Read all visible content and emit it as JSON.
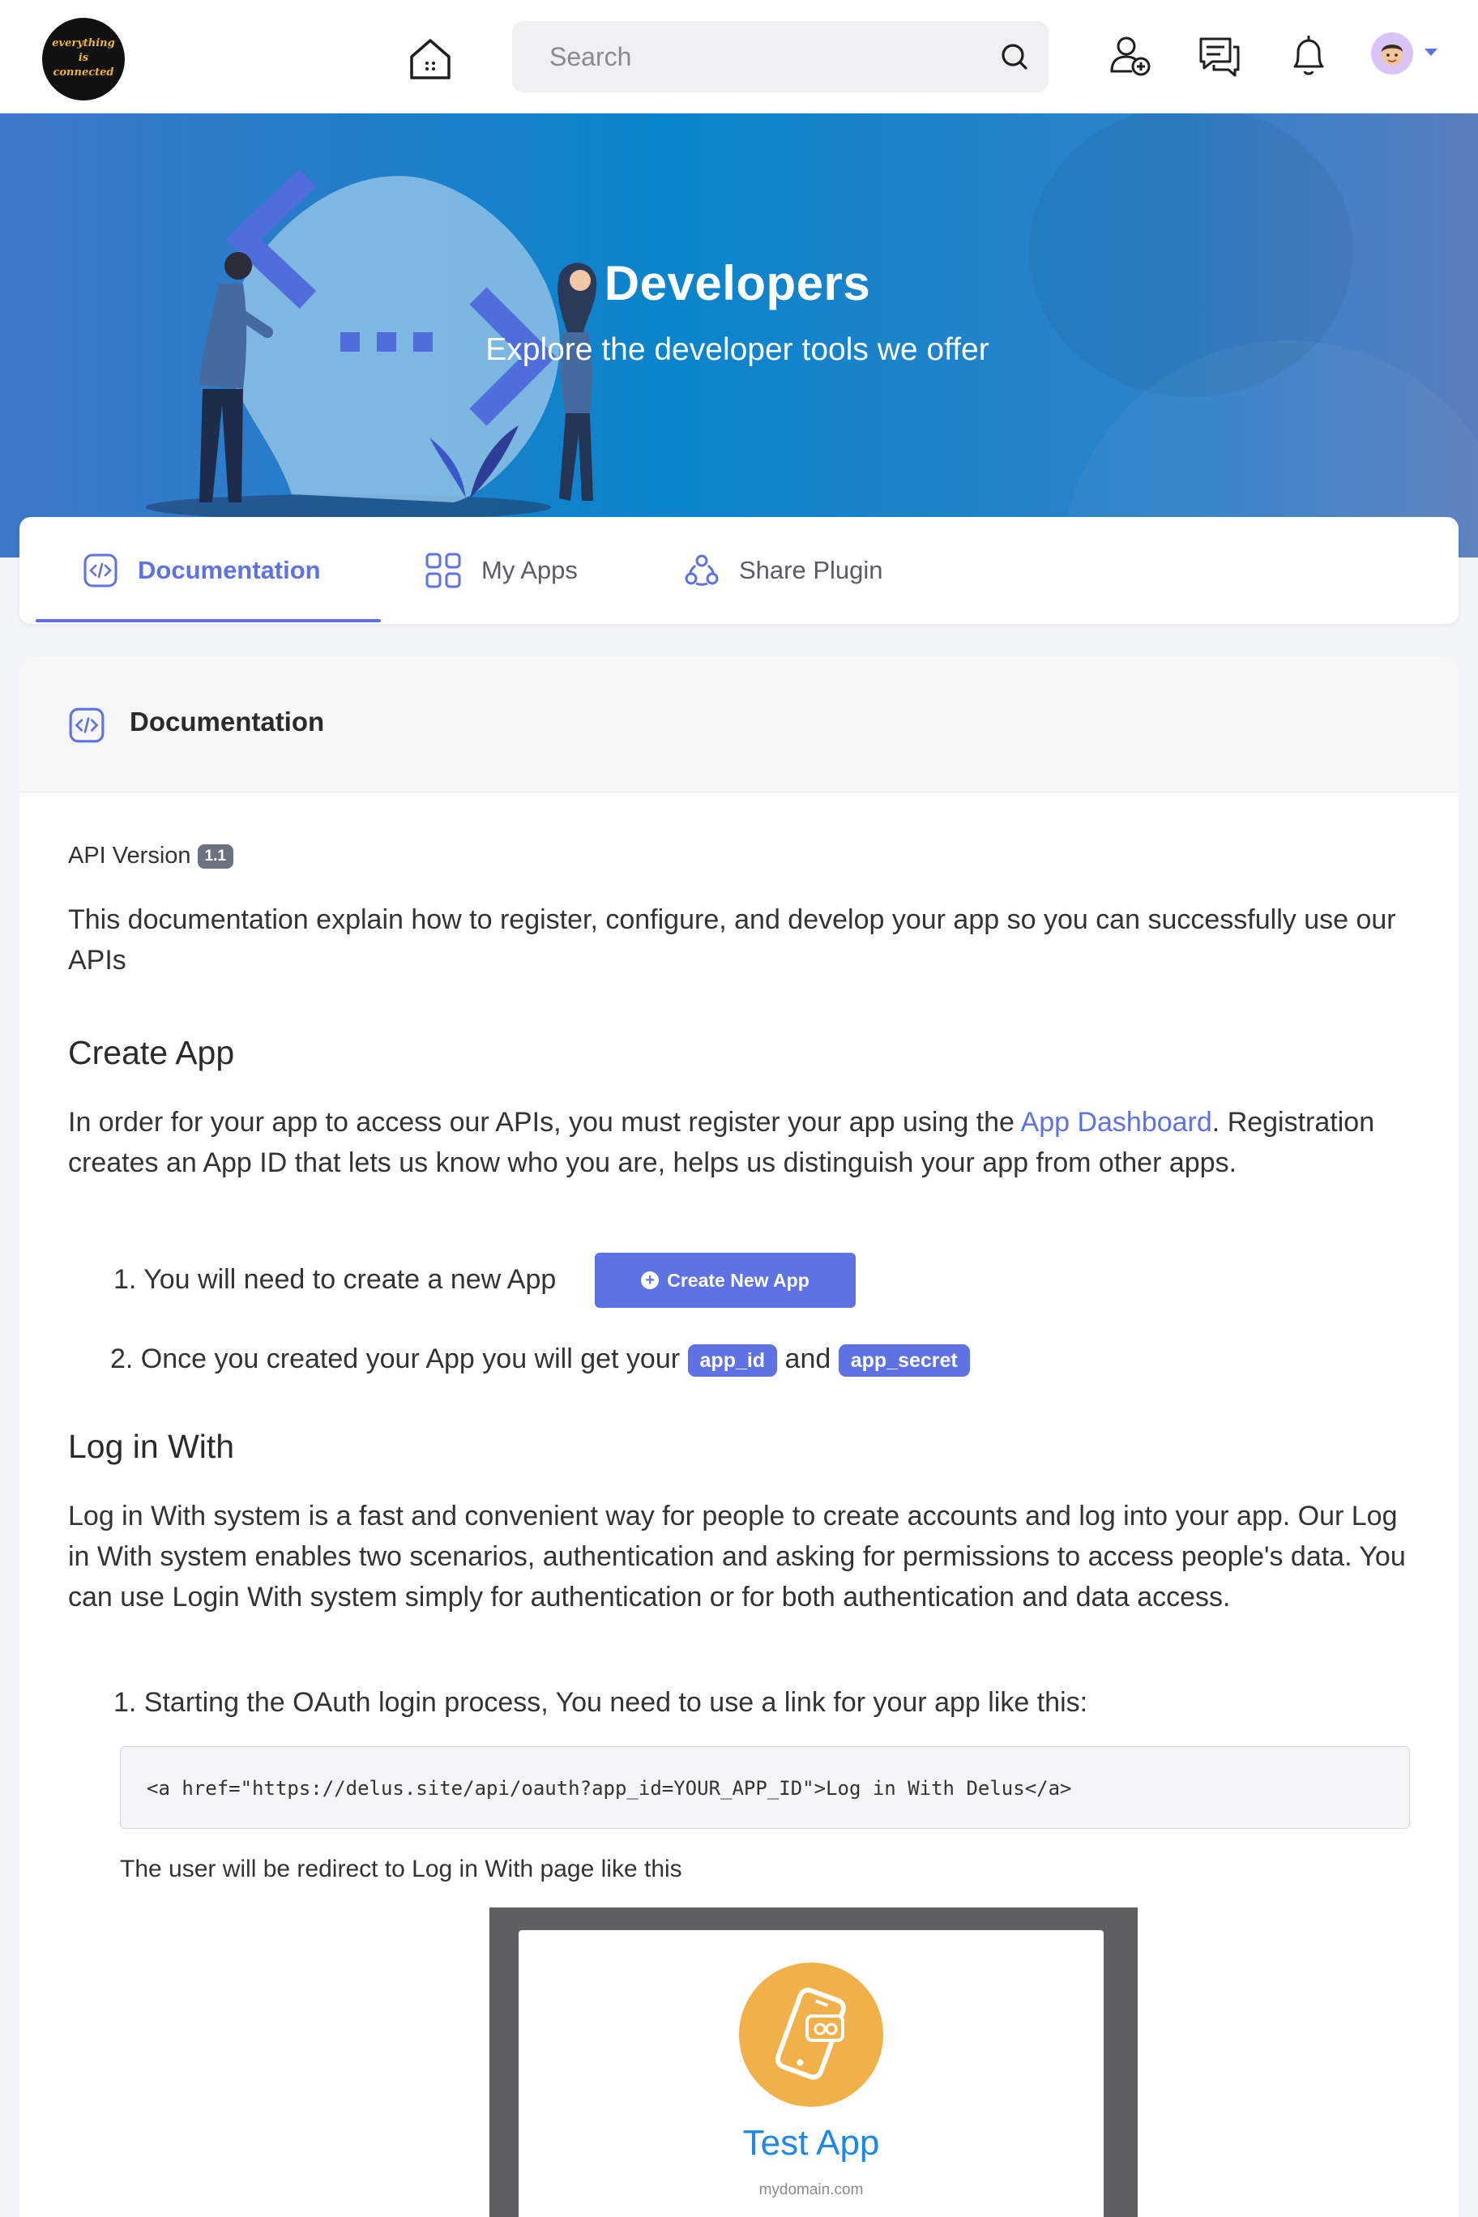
{
  "header": {
    "logo_text_lines": [
      "everything",
      "is",
      "connected"
    ],
    "search_placeholder": "Search"
  },
  "hero": {
    "title": "Developers",
    "subtitle": "Explore the developer tools we offer"
  },
  "tabs": [
    {
      "label": "Documentation",
      "icon": "code-icon",
      "active": true
    },
    {
      "label": "My Apps",
      "icon": "grid-icon",
      "active": false
    },
    {
      "label": "Share Plugin",
      "icon": "share-icon",
      "active": false
    }
  ],
  "section": {
    "title": "Documentation",
    "api_version_label": "API Version",
    "api_version": "1.1",
    "intro": "This documentation explain how to register, configure, and develop your app so you can successfully use our APIs",
    "create_app": {
      "heading": "Create App",
      "para_before_link": "In order for your app to access our APIs, you must register your app using the ",
      "link_text": "App Dashboard",
      "para_after_link": ". Registration creates an App ID that lets us know who you are, helps us distinguish your app from other apps.",
      "step1": "1. You will need to create a new App",
      "create_button": "Create New App",
      "step2_prefix": "2. Once you created your App you will get your",
      "app_id_badge": "app_id",
      "and_text": "and",
      "app_secret_badge": "app_secret"
    },
    "login_with": {
      "heading": "Log in With",
      "para": "Log in With system is a fast and convenient way for people to create accounts and log into your app. Our Log in With system enables two scenarios, authentication and asking for permissions to access people's data. You can use Login With system simply for authentication or for both authentication and data access.",
      "step1": "1. Starting the OAuth login process, You need to use a link for your app like this:",
      "code": "<a href=\"https://delus.site/api/oauth?app_id=YOUR_APP_ID\">Log in With Delus</a>",
      "redirect_note": "The user will be redirect to Log in With page like this",
      "preview_app_name": "Test App",
      "preview_domain": "mydomain.com"
    }
  },
  "colors": {
    "accent": "#5e72e4",
    "hero_blue": "#0a84cc",
    "app_orange": "#f2b04a"
  }
}
